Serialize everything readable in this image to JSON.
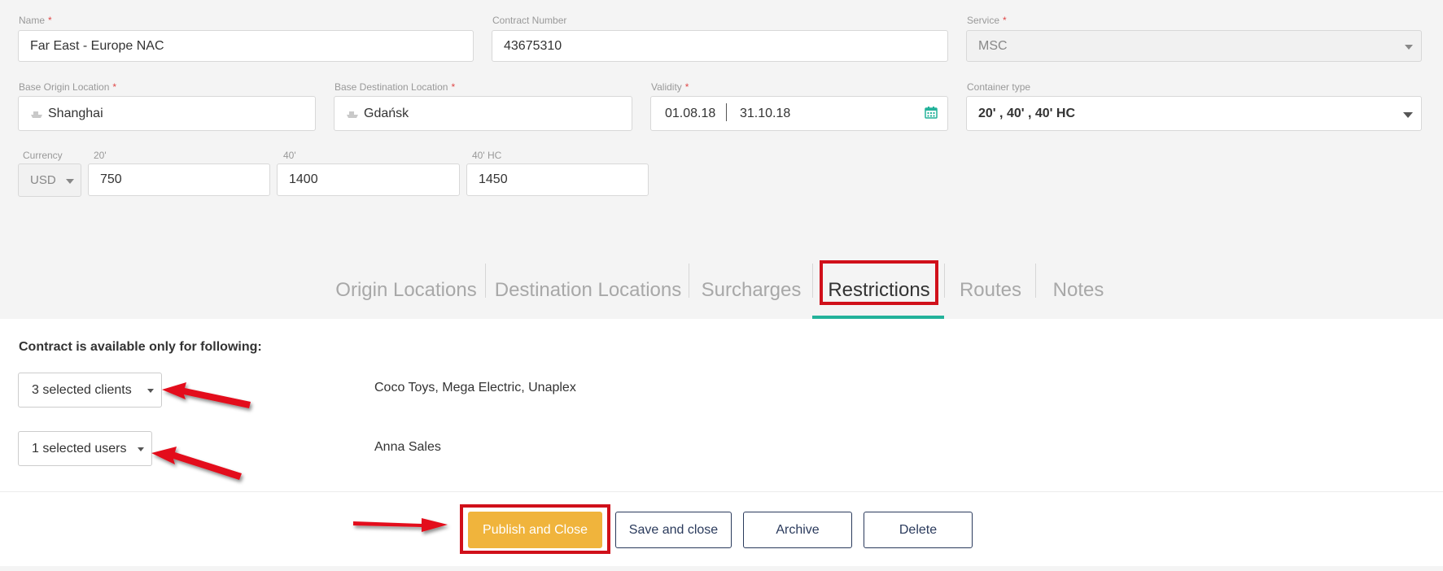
{
  "fields": {
    "name": {
      "label": "Name",
      "value": "Far East - Europe NAC"
    },
    "contract_number": {
      "label": "Contract Number",
      "value": "43675310"
    },
    "service": {
      "label": "Service",
      "value": "MSC"
    },
    "base_origin": {
      "label": "Base Origin Location",
      "value": "Shanghai"
    },
    "base_destination": {
      "label": "Base Destination Location",
      "value": "Gdańsk"
    },
    "validity": {
      "label": "Validity",
      "from": "01.08.18",
      "to": "31.10.18"
    },
    "container_type": {
      "label": "Container type",
      "value": "20' , 40' , 40' HC"
    },
    "currency": {
      "label": "Currency",
      "value": "USD"
    },
    "rate_20": {
      "label": "20'",
      "value": "750"
    },
    "rate_40": {
      "label": "40'",
      "value": "1400"
    },
    "rate_40hc": {
      "label": "40' HC",
      "value": "1450"
    },
    "required_mark": "*"
  },
  "tabs": [
    {
      "label": "Origin Locations"
    },
    {
      "label": "Destination Locations"
    },
    {
      "label": "Surcharges"
    },
    {
      "label": "Restrictions",
      "active": true
    },
    {
      "label": "Routes"
    },
    {
      "label": "Notes"
    }
  ],
  "restrictions": {
    "title": "Contract is available only for following:",
    "clients_dropdown": "3 selected clients",
    "clients_list": "Coco Toys, Mega Electric, Unaplex",
    "users_dropdown": "1 selected users",
    "users_list": "Anna Sales"
  },
  "actions": {
    "publish": "Publish and Close",
    "save": "Save and close",
    "archive": "Archive",
    "delete": "Delete"
  },
  "colors": {
    "accent": "#23b29a",
    "primary_button": "#f0b43c",
    "highlight": "#d0101a",
    "required": "#e04848"
  }
}
